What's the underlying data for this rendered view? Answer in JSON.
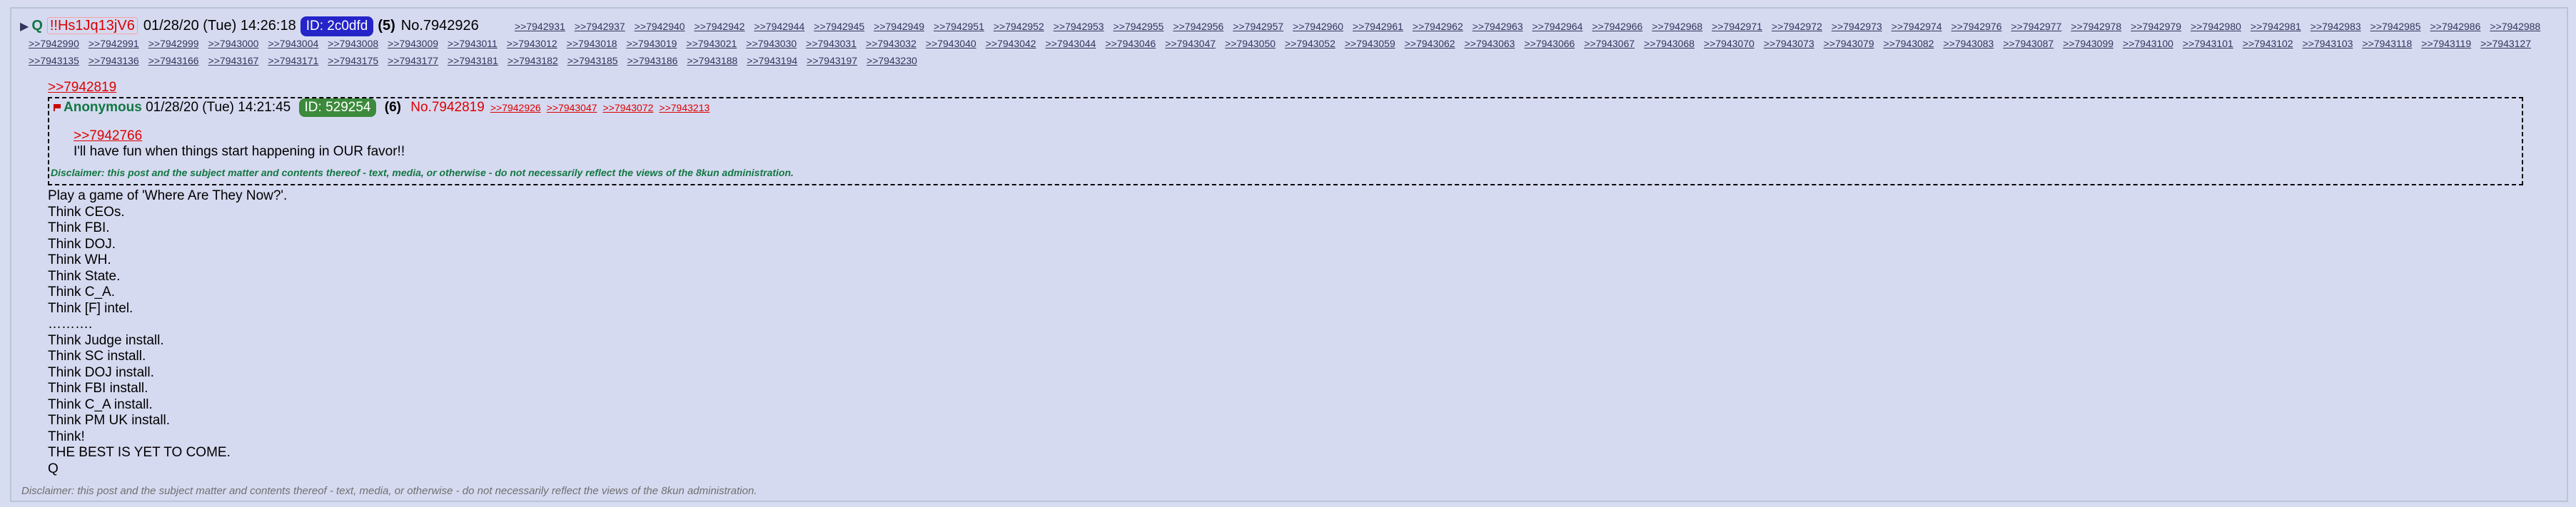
{
  "post": {
    "arrow": "▶",
    "name": "Q",
    "tripcode": "!!Hs1Jq13jV6",
    "date": "01/28/20 (Tue) 14:26:18",
    "id": "ID: 2c0dfd",
    "count": "(5)",
    "number": "No.7942926",
    "replies": [
      ">>7942931",
      ">>7942937",
      ">>7942940",
      ">>7942942",
      ">>7942944",
      ">>7942945",
      ">>7942949",
      ">>7942951",
      ">>7942952",
      ">>7942953",
      ">>7942955",
      ">>7942956",
      ">>7942957",
      ">>7942960",
      ">>7942961",
      ">>7942962",
      ">>7942963",
      ">>7942964",
      ">>7942966",
      ">>7942968",
      ">>7942971",
      ">>7942972",
      ">>7942973",
      ">>7942974",
      ">>7942976",
      ">>7942977",
      ">>7942978",
      ">>7942979",
      ">>7942980",
      ">>7942981",
      ">>7942983",
      ">>7942985",
      ">>7942986",
      ">>7942988",
      ">>7942990",
      ">>7942991",
      ">>7942999",
      ">>7943000",
      ">>7943004",
      ">>7943008",
      ">>7943009",
      ">>7943011",
      ">>7943012",
      ">>7943018",
      ">>7943019",
      ">>7943021",
      ">>7943030",
      ">>7943031",
      ">>7943032",
      ">>7943040",
      ">>7943042",
      ">>7943044",
      ">>7943046",
      ">>7943047",
      ">>7943050",
      ">>7943052",
      ">>7943059",
      ">>7943062",
      ">>7943063",
      ">>7943066",
      ">>7943067",
      ">>7943068",
      ">>7943070",
      ">>7943073",
      ">>7943079",
      ">>7943082",
      ">>7943083",
      ">>7943087",
      ">>7943099",
      ">>7943100",
      ">>7943101",
      ">>7943102",
      ">>7943103",
      ">>7943118",
      ">>7943119",
      ">>7943127",
      ">>7943135",
      ">>7943136",
      ">>7943166",
      ">>7943167",
      ">>7943171",
      ">>7943175",
      ">>7943177",
      ">>7943181",
      ">>7943182",
      ">>7943185",
      ">>7943186",
      ">>7943188",
      ">>7943194",
      ">>7943197",
      ">>7943230"
    ],
    "quote_link": ">>7942819",
    "quoted": {
      "name": "Anonymous",
      "date": "01/28/20 (Tue) 14:21:45",
      "id": "ID: 529254",
      "count": "(6)",
      "number": "No.7942819",
      "replies": [
        ">>7942926",
        ">>7943047",
        ">>7943072",
        ">>7943213"
      ],
      "quote_link": ">>7942766",
      "text": "I'll have fun when things start happening in OUR favor!!",
      "disclaimer": "Disclaimer: this post and the subject matter and contents thereof - text, media, or otherwise - do not necessarily reflect the views of the 8kun administration."
    },
    "lines": [
      "Play a game of 'Where Are They Now?'.",
      "Think CEOs.",
      "Think FBI.",
      "Think DOJ.",
      "Think WH.",
      "Think State.",
      "Think C_A.",
      "Think [F] intel.",
      "……….",
      "Think Judge install.",
      "Think SC install.",
      "Think DOJ install.",
      "Think FBI install.",
      "Think C_A install.",
      "Think PM UK install.",
      "Think!",
      "THE BEST IS YET TO COME.",
      "Q"
    ],
    "disclaimer": "Disclaimer: this post and the subject matter and contents thereof - text, media, or otherwise - do not necessarily reflect the views of the 8kun administration."
  },
  "colors": {
    "background": "#d6daf0",
    "name": "#117743",
    "quote": "#dd0000",
    "id_badge": "#2424c9"
  }
}
